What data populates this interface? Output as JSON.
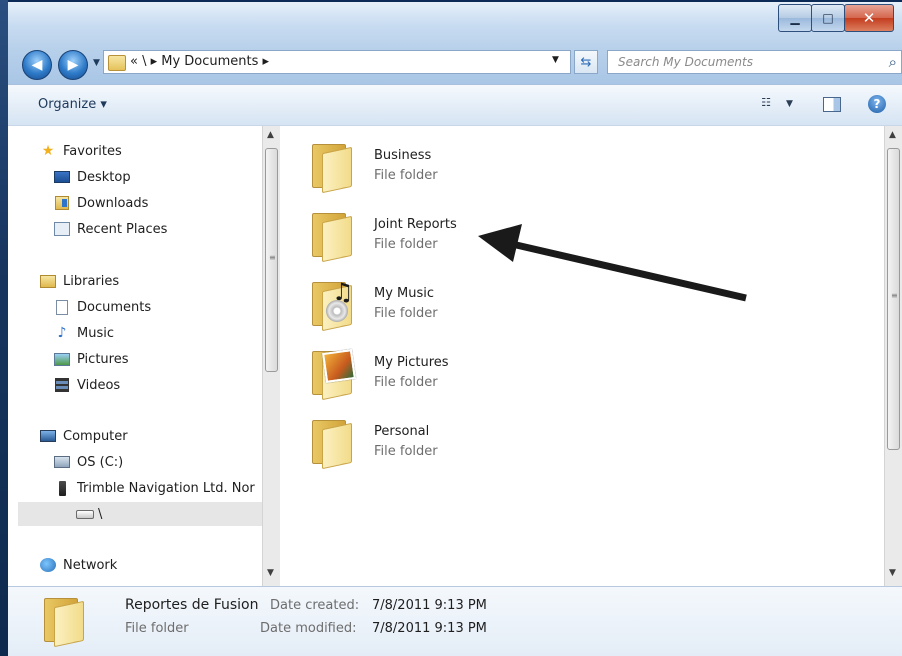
{
  "address_bar": {
    "path_text": "« \\ ▸ My Documents ▸",
    "search_placeholder": "Search My Documents"
  },
  "toolbar": {
    "organize_label": "Organize ▾"
  },
  "nav_pane": {
    "favorites": {
      "label": "Favorites",
      "items": [
        "Desktop",
        "Downloads",
        "Recent Places"
      ]
    },
    "libraries": {
      "label": "Libraries",
      "items": [
        "Documents",
        "Music",
        "Pictures",
        "Videos"
      ]
    },
    "computer": {
      "label": "Computer",
      "items": [
        "OS (C:)",
        "Trimble Navigation Ltd. Nor",
        "\\"
      ]
    },
    "network": {
      "label": "Network"
    }
  },
  "content": {
    "items": [
      {
        "name": "Business",
        "type": "File folder",
        "icon": "folder-icon"
      },
      {
        "name": "Joint Reports",
        "type": "File folder",
        "icon": "folder-icon"
      },
      {
        "name": "My Music",
        "type": "File folder",
        "icon": "music-folder-icon"
      },
      {
        "name": "My Pictures",
        "type": "File folder",
        "icon": "pictures-folder-icon"
      },
      {
        "name": "Personal",
        "type": "File folder",
        "icon": "folder-icon"
      }
    ]
  },
  "details": {
    "name": "Reportes de Fusion",
    "type": "File folder",
    "date_created_label": "Date created:",
    "date_created": "7/8/2011 9:13 PM",
    "date_modified_label": "Date modified:",
    "date_modified": "7/8/2011 9:13 PM"
  },
  "colors": {
    "selection_gray": "#e6e6e6",
    "arrow": "#1a1a1a",
    "chrome_blue": "#b7d0ea"
  }
}
